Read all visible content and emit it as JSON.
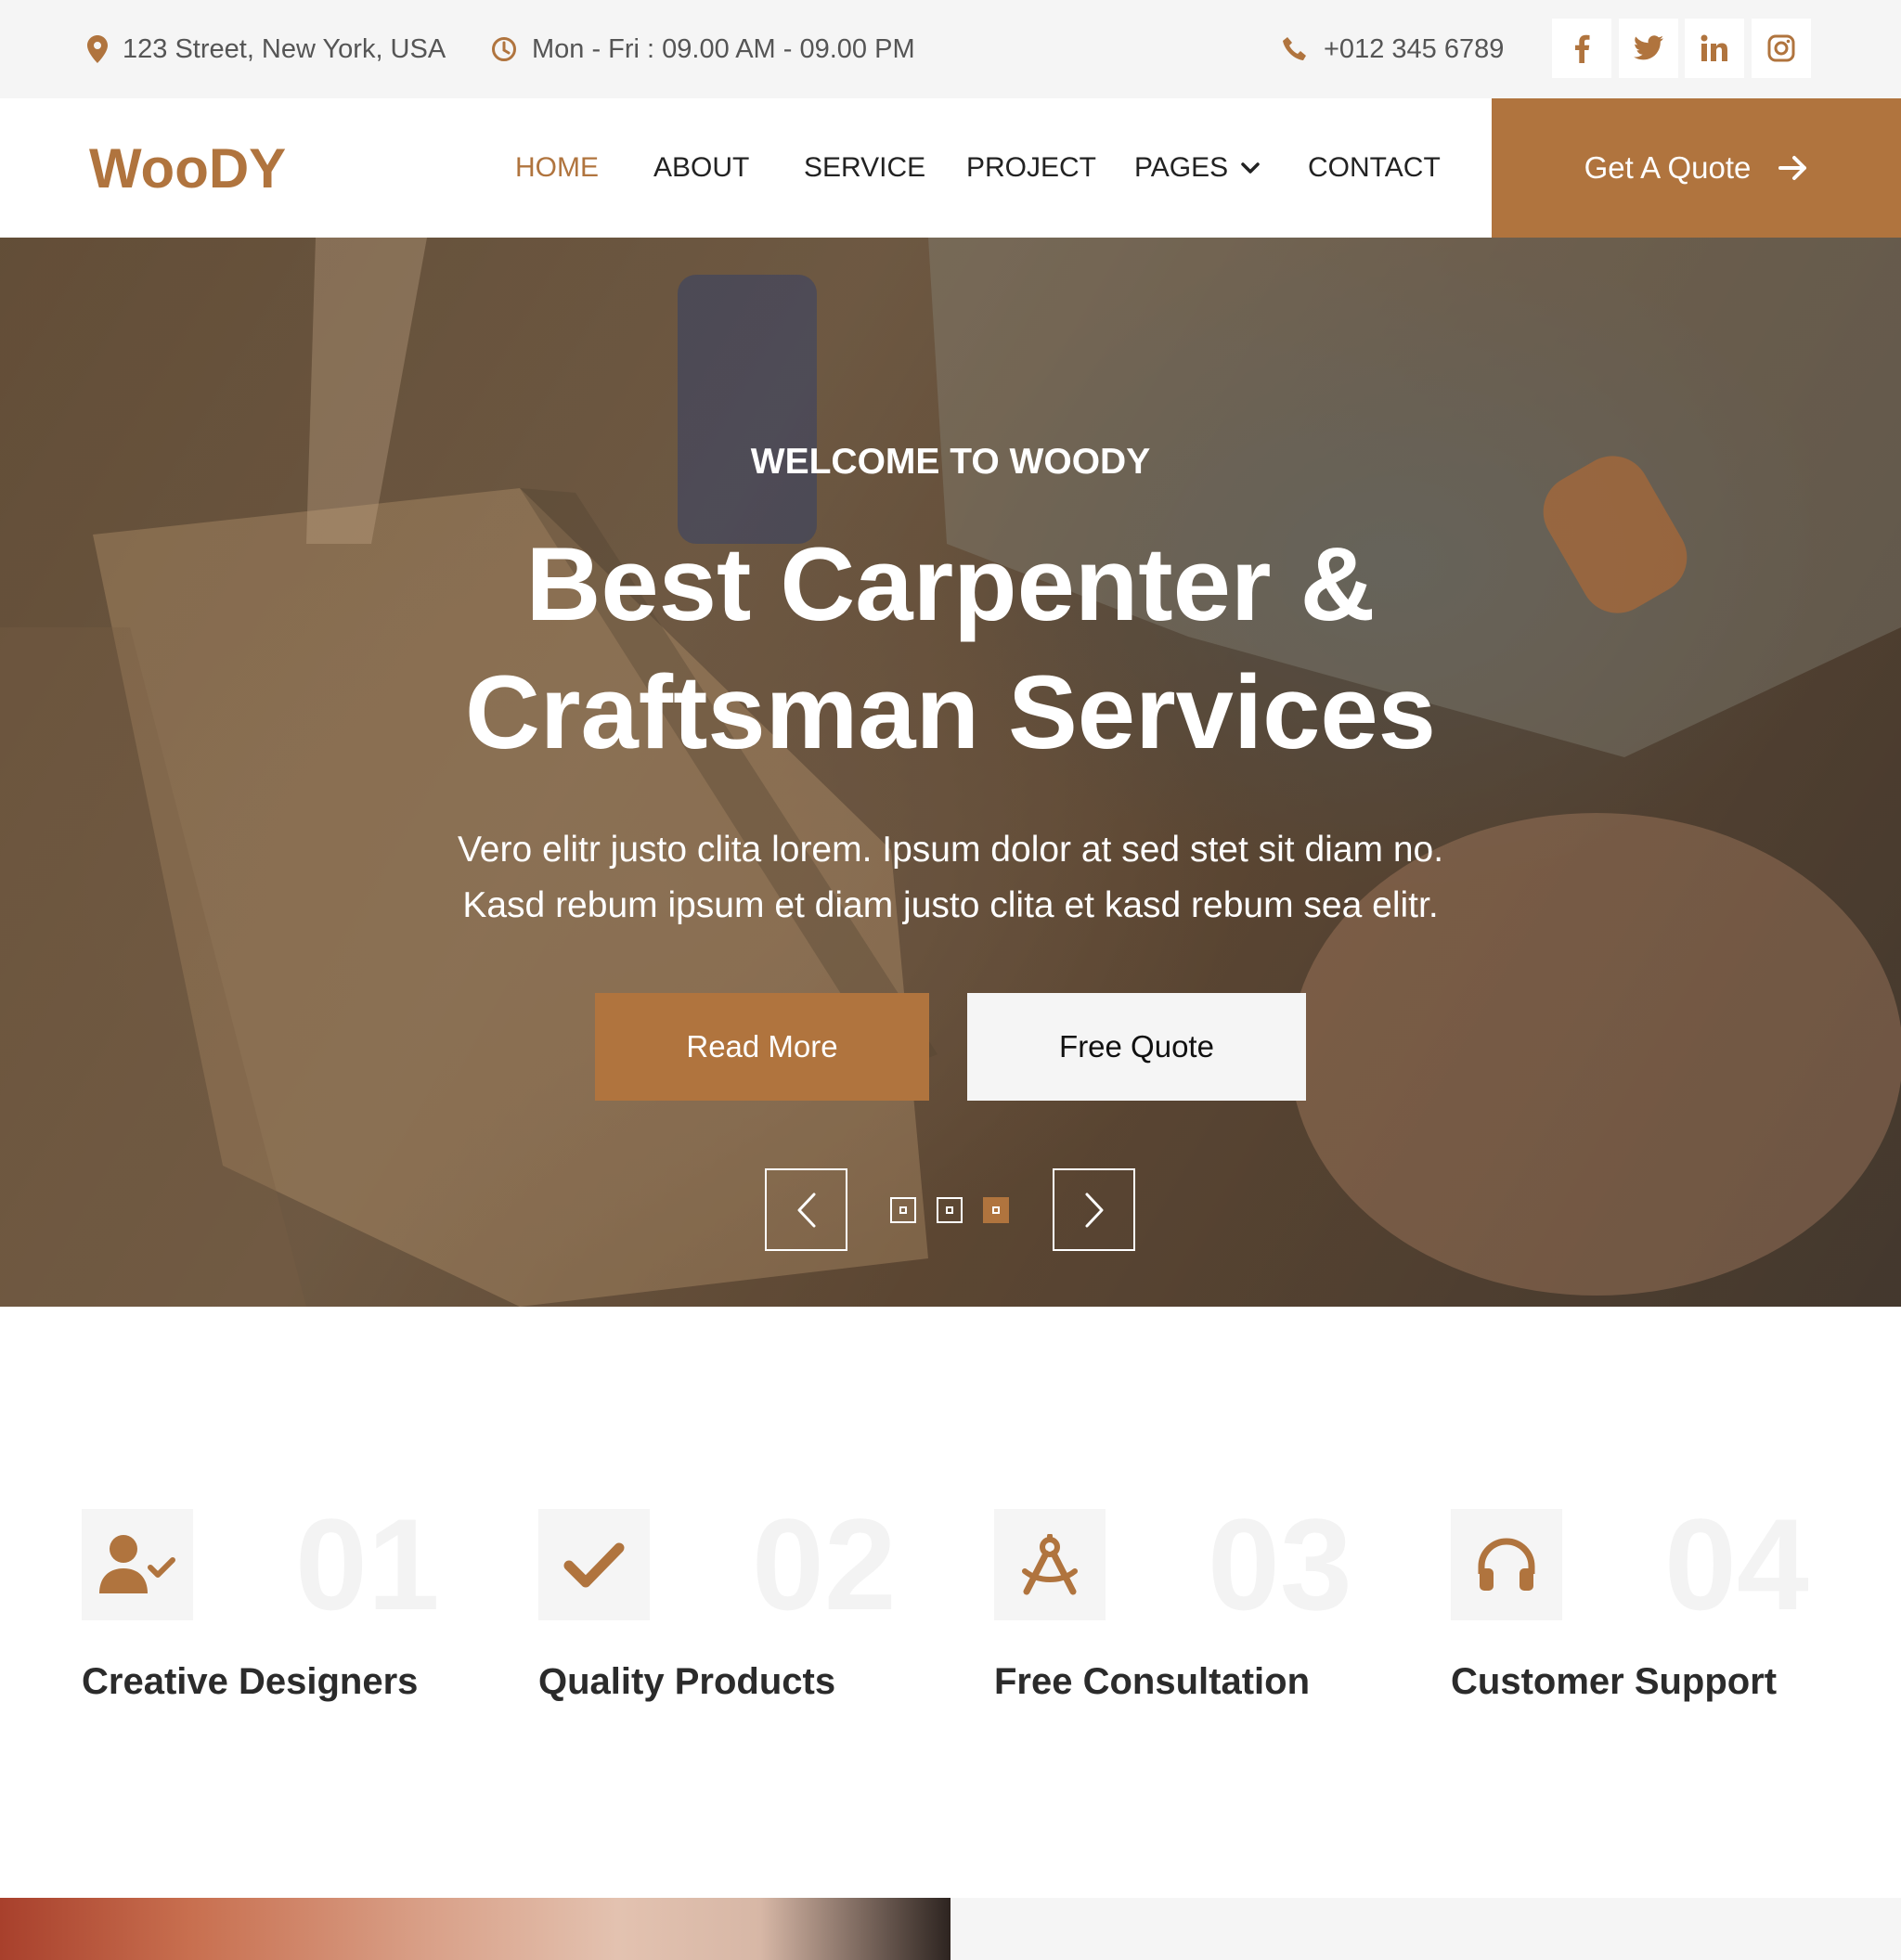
{
  "topbar": {
    "address": "123 Street, New York, USA",
    "hours": "Mon - Fri : 09.00 AM - 09.00 PM",
    "phone": "+012 345 6789",
    "socials": [
      "facebook-icon",
      "twitter-icon",
      "linkedin-icon",
      "instagram-icon"
    ]
  },
  "navbar": {
    "logo": "WooDY",
    "items": {
      "home": "HOME",
      "about": "ABOUT",
      "service": "SERVICE",
      "project": "PROJECT",
      "pages": "PAGES",
      "contact": "CONTACT"
    },
    "active": "HOME",
    "quote_button": "Get A Quote"
  },
  "hero": {
    "kicker": "WELCOME TO WOODY",
    "title_line1": "Best Carpenter &",
    "title_line2": "Craftsman Services",
    "desc_line1": "Vero elitr justo clita lorem. Ipsum dolor at sed stet sit diam no.",
    "desc_line2": "Kasd rebum ipsum et diam justo clita et kasd rebum sea elitr.",
    "read_more": "Read More",
    "free_quote": "Free Quote",
    "carousel_active_slide": 3,
    "carousel_total_slides": 3
  },
  "features": [
    {
      "num": "01",
      "title": "Creative Designers",
      "icon": "user-check-icon"
    },
    {
      "num": "02",
      "title": "Quality Products",
      "icon": "check-icon"
    },
    {
      "num": "03",
      "title": "Free Consultation",
      "icon": "drafting-compass-icon"
    },
    {
      "num": "04",
      "title": "Customer Support",
      "icon": "headphones-icon"
    }
  ],
  "colors": {
    "accent": "#b0743e",
    "topbar_bg": "#f5f5f5",
    "heading": "#2b2b2b"
  }
}
